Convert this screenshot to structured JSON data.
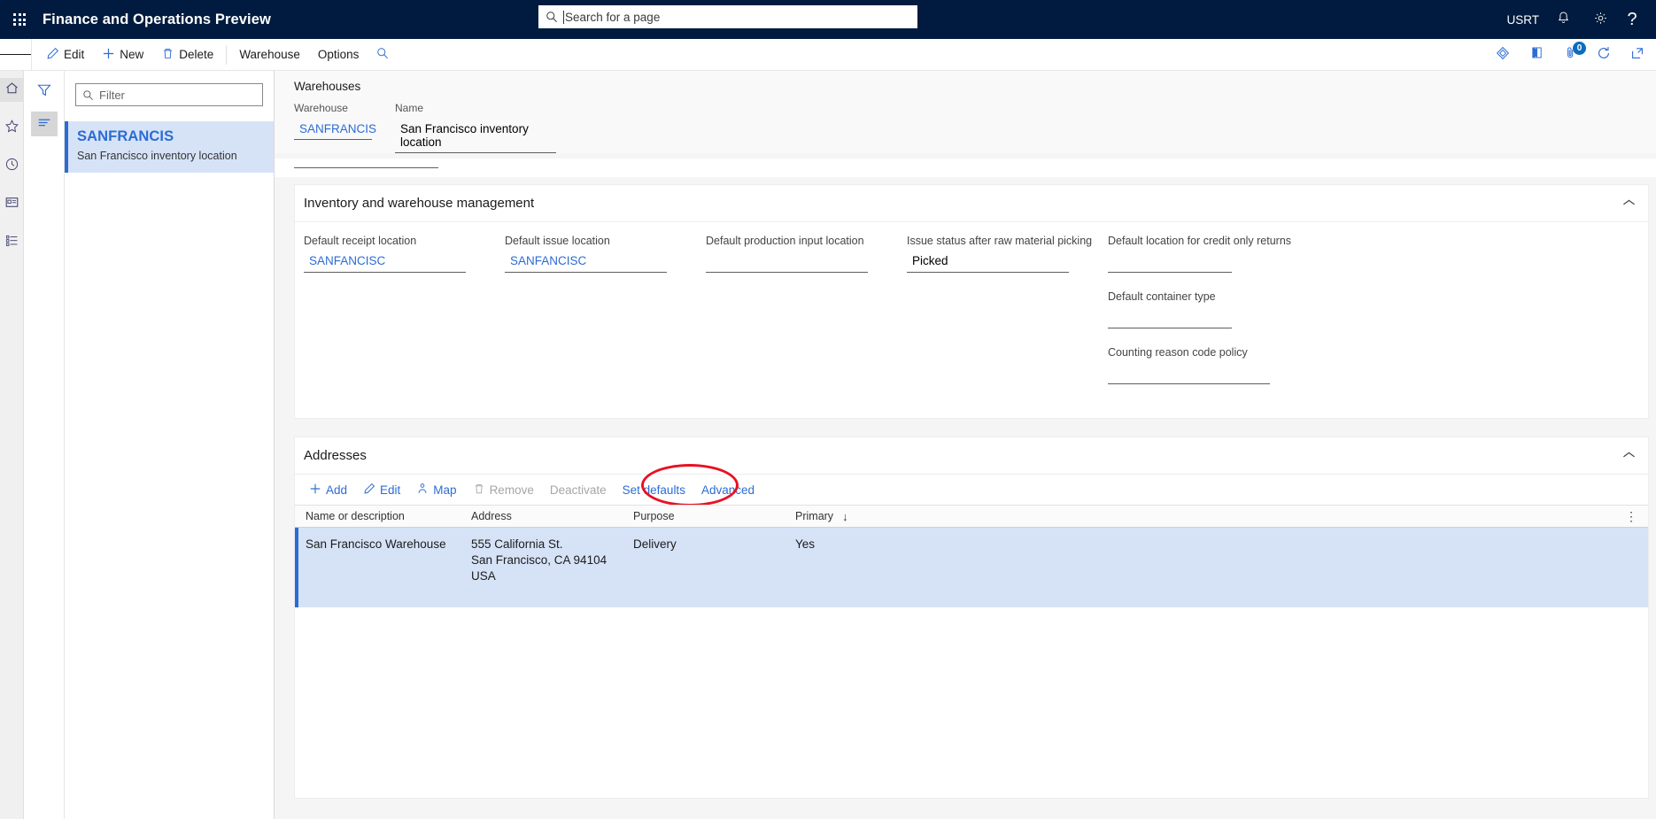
{
  "topbar": {
    "waffle_label": "app-launcher",
    "app_title": "Finance and Operations Preview",
    "search_placeholder": "Search for a page",
    "company": "USRT",
    "notifications_icon": "bell-icon",
    "settings_icon": "gear-icon",
    "help_icon": "help-icon"
  },
  "commandbar": {
    "menu_icon": "hamburger-icon",
    "buttons": [
      {
        "label": "Edit",
        "icon": "pencil-icon"
      },
      {
        "label": "New",
        "icon": "plus-icon"
      },
      {
        "label": "Delete",
        "icon": "trash-icon"
      },
      {
        "label": "Warehouse",
        "icon": ""
      },
      {
        "label": "Options",
        "icon": ""
      }
    ],
    "search_icon": "search-icon",
    "right_icons": [
      {
        "name": "personalize-icon"
      },
      {
        "name": "office-icon"
      },
      {
        "name": "attachments-icon",
        "badge": "0"
      },
      {
        "name": "refresh-icon"
      },
      {
        "name": "open-in-new-icon"
      }
    ]
  },
  "rail": {
    "items": [
      {
        "name": "home-icon"
      },
      {
        "name": "favorites-star-icon"
      },
      {
        "name": "recent-clock-icon"
      },
      {
        "name": "workspaces-icon"
      },
      {
        "name": "modules-list-icon"
      }
    ]
  },
  "filterpane": {
    "filter_icon": "filter-icon",
    "list_icon": "list-lines-icon"
  },
  "listpane": {
    "filter_placeholder": "Filter",
    "items": [
      {
        "title": "SANFRANCIS",
        "subtitle": "San Francisco inventory location"
      }
    ]
  },
  "form": {
    "caption": "Warehouses",
    "header_fields": [
      {
        "label": "Warehouse",
        "value": "SANFRANCIS",
        "link": true
      },
      {
        "label": "Name",
        "value": "San Francisco inventory location",
        "link": false
      }
    ]
  },
  "inventory_section": {
    "title": "Inventory and warehouse management",
    "collapse_icon": "chevron-up-icon",
    "fields": [
      {
        "label": "Default receipt location",
        "value": "SANFANCISC",
        "link": true
      },
      {
        "label": "Default issue location",
        "value": "SANFANCISC",
        "link": true
      },
      {
        "label": "Default production input location",
        "value": "",
        "link": true
      },
      {
        "label": "Issue status after raw material picking",
        "value": "Picked",
        "link": false
      },
      {
        "label": "Default location for credit only returns",
        "value": "",
        "link": true
      },
      {
        "label": "Default container type",
        "value": "",
        "link": true
      },
      {
        "label": "Counting reason code policy",
        "value": "",
        "link": true
      }
    ]
  },
  "addresses_section": {
    "title": "Addresses",
    "collapse_icon": "chevron-up-icon",
    "toolbar": [
      {
        "label": "Add",
        "icon": "plus-icon",
        "disabled": false
      },
      {
        "label": "Edit",
        "icon": "pencil-icon",
        "disabled": false
      },
      {
        "label": "Map",
        "icon": "map-pin-icon",
        "disabled": false
      },
      {
        "label": "Remove",
        "icon": "trash-icon",
        "disabled": true
      },
      {
        "label": "Deactivate",
        "icon": "",
        "disabled": true
      },
      {
        "label": "Set defaults",
        "icon": "",
        "disabled": false
      },
      {
        "label": "Advanced",
        "icon": "",
        "disabled": false
      }
    ],
    "annotation": {
      "target": "Advanced",
      "color": "#e81123"
    },
    "columns": [
      "Name or description",
      "Address",
      "Purpose",
      "Primary"
    ],
    "sort_indicator": "↓",
    "more_icon": "grid-options-icon",
    "rows": [
      {
        "name": "San Francisco Warehouse",
        "address_line1": "555 California St.",
        "address_line2": "San Francisco, CA 94104",
        "address_line3": "USA",
        "purpose": "Delivery",
        "primary": "Yes"
      }
    ]
  },
  "colors": {
    "navbar": "#001b3f",
    "accent": "#2b6cd4",
    "selection": "#d6e3f7",
    "annotation": "#e81123"
  }
}
